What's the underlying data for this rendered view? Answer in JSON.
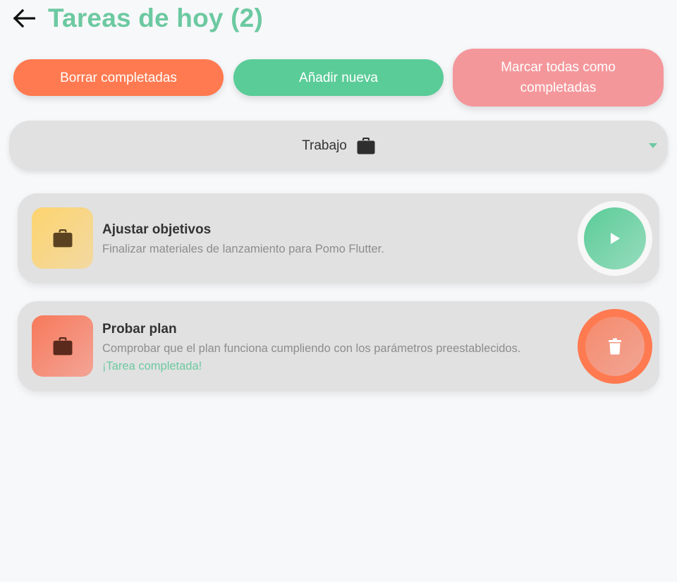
{
  "header": {
    "title": "Tareas de hoy (2)",
    "back_icon": "arrow-left-icon"
  },
  "actions": {
    "clear_completed_label": "Borrar completadas",
    "add_new_label": "Añadir nueva",
    "mark_all_label": "Marcar todas como completadas"
  },
  "category": {
    "selected": "Trabajo",
    "icon": "briefcase-icon"
  },
  "tasks": [
    {
      "title": "Ajustar objetivos",
      "description": "Finalizar materiales de lanzamiento para Pomo Flutter.",
      "completed": false,
      "status_text": "",
      "icon": "briefcase-icon",
      "action_icon": "play-icon"
    },
    {
      "title": "Probar plan",
      "description": "Comprobar que el plan funciona cumpliendo con los parámetros preestablecidos.",
      "completed": true,
      "status_text": "¡Tarea completada!",
      "icon": "briefcase-icon",
      "action_icon": "trash-icon"
    }
  ],
  "colors": {
    "accent_green": "#6cc9a1",
    "button_orange": "#ff7a50",
    "button_green": "#5acc98",
    "button_pink": "#f4979b",
    "card_bg": "#e1e1e1"
  }
}
